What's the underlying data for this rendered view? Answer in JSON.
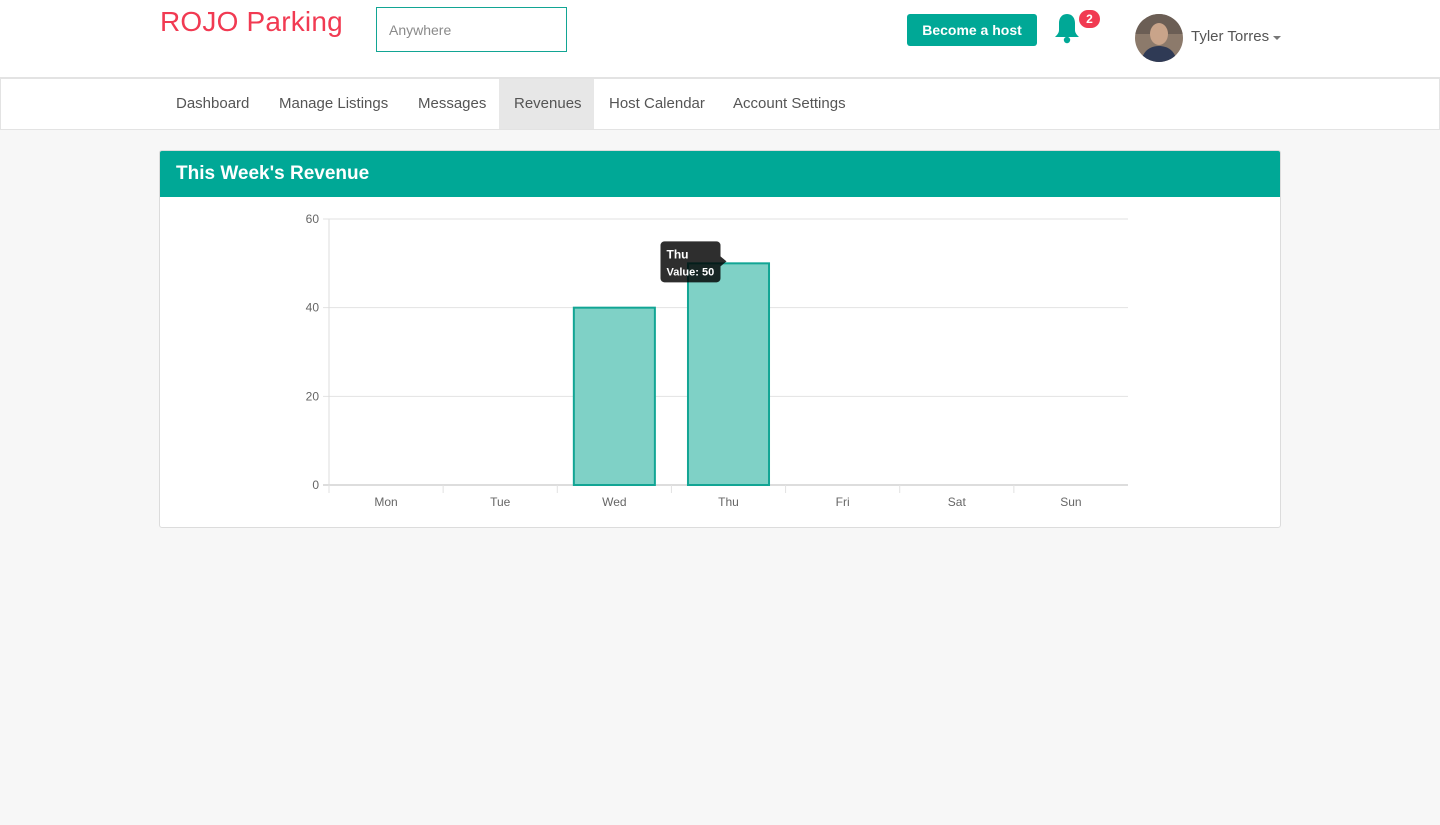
{
  "header": {
    "brand": "ROJO Parking",
    "search_placeholder": "Anywhere",
    "become_host_label": "Become a host",
    "notification_count": "2",
    "user_name": "Tyler Torres"
  },
  "nav": {
    "items": [
      {
        "label": "Dashboard"
      },
      {
        "label": "Manage Listings"
      },
      {
        "label": "Messages"
      },
      {
        "label": "Revenues",
        "active": true
      },
      {
        "label": "Host Calendar"
      },
      {
        "label": "Account Settings"
      }
    ]
  },
  "panel": {
    "title": "This Week's Revenue"
  },
  "chart_data": {
    "type": "bar",
    "categories": [
      "Mon",
      "Tue",
      "Wed",
      "Thu",
      "Fri",
      "Sat",
      "Sun"
    ],
    "values": [
      0,
      0,
      40,
      50,
      0,
      0,
      0
    ],
    "ylim": [
      0,
      60
    ],
    "yticks": [
      0,
      20,
      40,
      60
    ],
    "grid": true,
    "tooltip": {
      "title": "Thu",
      "text": "Value: 50"
    }
  },
  "colors": {
    "brand": "#f13a52",
    "accent": "#00a896",
    "bar_fill": "#7fd1c6",
    "bar_stroke": "#12a594",
    "badge": "#f13a52"
  }
}
